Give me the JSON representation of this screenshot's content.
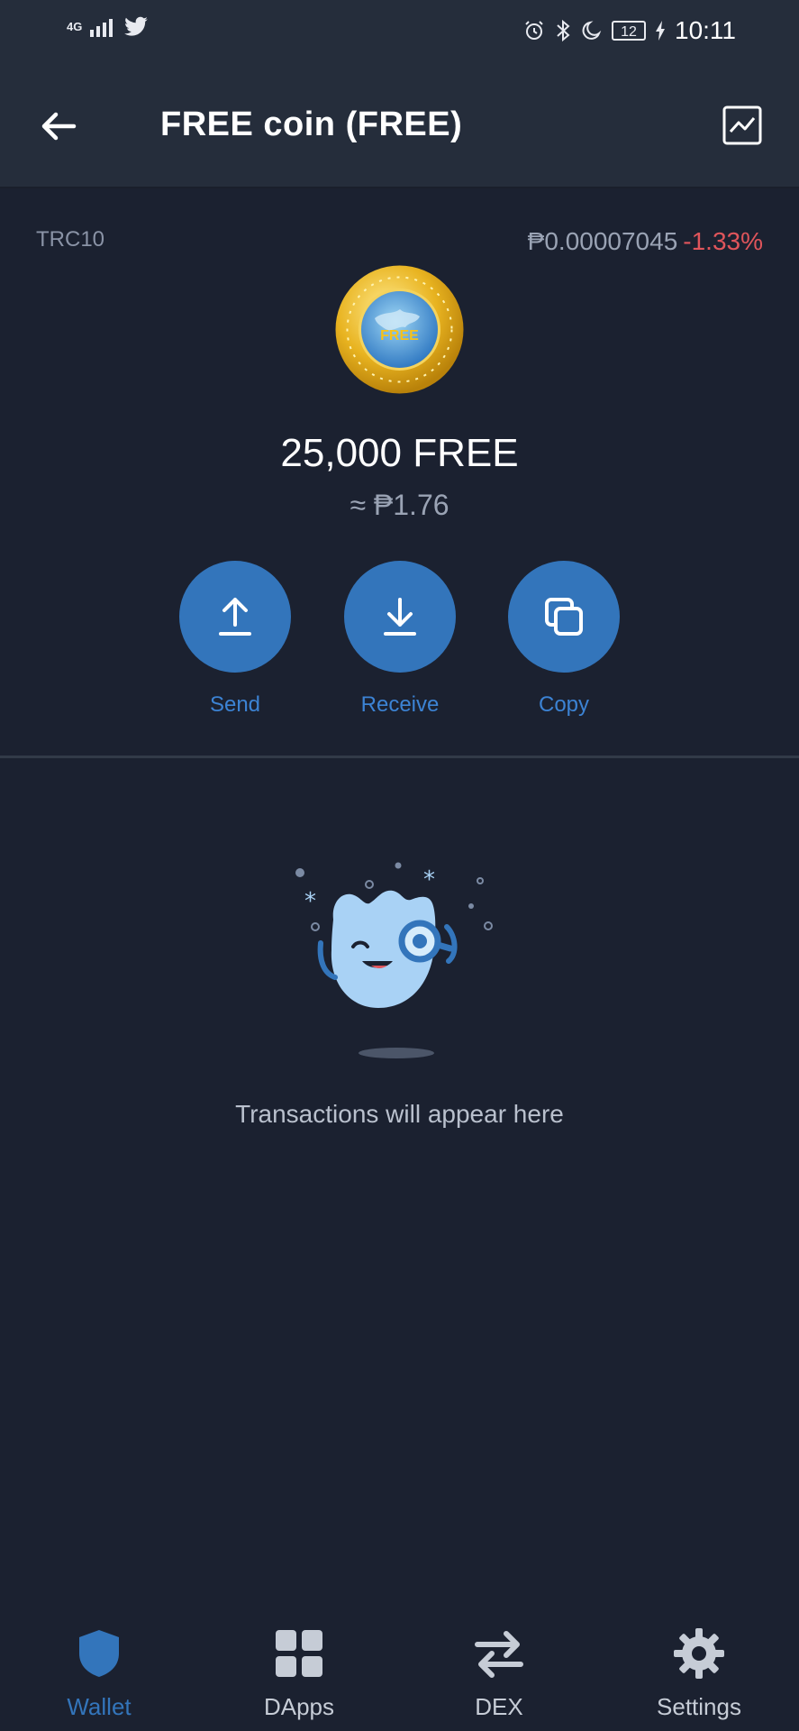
{
  "status_bar": {
    "network": "4G",
    "battery": "12",
    "time": "10:11"
  },
  "header": {
    "title": "FREE coin (FREE)",
    "back_icon": "arrow-left-icon",
    "chart_icon": "chart-icon"
  },
  "token": {
    "type": "TRC10",
    "price": "₱0.00007045",
    "change": "-1.33%",
    "change_color": "#e0555b",
    "balance": "25,000 FREE",
    "fiat_value": "≈ ₱1.76",
    "logo_text": "FREE"
  },
  "actions": [
    {
      "label": "Send",
      "icon": "upload-icon"
    },
    {
      "label": "Receive",
      "icon": "download-icon"
    },
    {
      "label": "Copy",
      "icon": "copy-icon"
    }
  ],
  "empty_state": {
    "message": "Transactions will appear here"
  },
  "bottom_nav": [
    {
      "label": "Wallet",
      "icon": "shield-icon",
      "active": true
    },
    {
      "label": "DApps",
      "icon": "grid-icon",
      "active": false
    },
    {
      "label": "DEX",
      "icon": "swap-icon",
      "active": false
    },
    {
      "label": "Settings",
      "icon": "gear-icon",
      "active": false
    }
  ],
  "colors": {
    "accent": "#3375bb",
    "background": "#1b2130",
    "header": "#252d3b"
  }
}
